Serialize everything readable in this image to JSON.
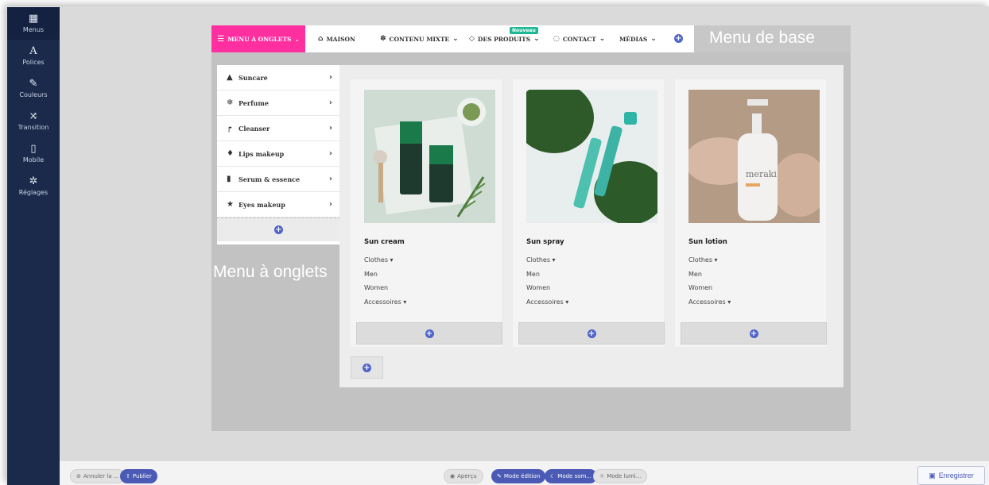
{
  "sidebar": {
    "items": [
      {
        "label": "Menus",
        "icon": "grid-icon"
      },
      {
        "label": "Polices",
        "icon": "font-icon"
      },
      {
        "label": "Couleurs",
        "icon": "brush-icon"
      },
      {
        "label": "Transition",
        "icon": "shuffle-icon"
      },
      {
        "label": "Mobile",
        "icon": "mobile-icon"
      },
      {
        "label": "Réglages",
        "icon": "gear-icon"
      }
    ]
  },
  "menubar": {
    "active_label": "MENU À ONGLETS",
    "items": [
      {
        "label": "MAISON",
        "icon": "home-icon"
      },
      {
        "label": "CONTENU MIXTE",
        "icon": "mixed-icon"
      },
      {
        "label": "DES PRODUITS",
        "icon": "diamond-icon"
      },
      {
        "label": "CONTACT",
        "icon": "chat-icon"
      },
      {
        "label": "MÉDIAS",
        "icon": ""
      }
    ],
    "new_badge": "Nouveau"
  },
  "annotations": {
    "base_menu": "Menu de base",
    "tab_menu": "Menu à onglets"
  },
  "tabs": [
    {
      "label": "Suncare",
      "icon": "hat-icon"
    },
    {
      "label": "Perfume",
      "icon": "snowflake-icon"
    },
    {
      "label": "Cleanser",
      "icon": "faucet-icon"
    },
    {
      "label": "Lips makeup",
      "icon": "lipstick-icon"
    },
    {
      "label": "Serum & essence",
      "icon": "spray-icon"
    },
    {
      "label": "Eyes makeup",
      "icon": "star-icon"
    }
  ],
  "products": [
    {
      "title": "Sun cream",
      "links": [
        "Clothes",
        "Men",
        "Women",
        "Accessoires"
      ]
    },
    {
      "title": "Sun spray",
      "links": [
        "Clothes",
        "Men",
        "Women",
        "Accessoires"
      ]
    },
    {
      "title": "Sun lotion",
      "links": [
        "Clothes",
        "Men",
        "Women",
        "Accessoires"
      ]
    }
  ],
  "bottombar": {
    "undo": "Annuler la ...",
    "publish": "Publier",
    "preview": "Aperçu",
    "edit_mode": "Mode édition",
    "dark_mode": "Mode som...",
    "light_mode": "Mode lumi...",
    "save": "Enregistrer"
  },
  "colors": {
    "sidebar": "#1b2a4a",
    "active_tab": "#ff2fa0",
    "accent": "#4b5bb5",
    "badge": "#1db995"
  }
}
